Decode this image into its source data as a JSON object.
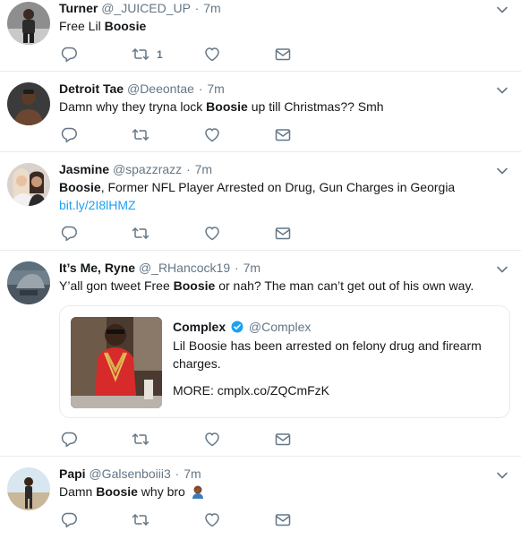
{
  "tweets": [
    {
      "name": "Turner",
      "handle": "@_JUICED_UP",
      "sep": "·",
      "time": "7m",
      "text_before": "Free Lil ",
      "text_bold": "Boosie",
      "text_after": "",
      "retweet_count": "1"
    },
    {
      "name": "Detroit Tae",
      "handle": "@Deeontae",
      "sep": "·",
      "time": "7m",
      "text_before": "Damn why they tryna lock ",
      "text_bold": "Boosie",
      "text_after": " up till Christmas?? Smh"
    },
    {
      "name": "Jasmine",
      "handle": "@spazzrazz",
      "sep": "·",
      "time": "7m",
      "text_bold": "Boosie",
      "text_after": ", Former NFL Player Arrested on Drug, Gun Charges in Georgia",
      "link": "bit.ly/2I8lHMZ"
    },
    {
      "name": "It’s Me, Ryne",
      "handle": "@_RHancock19",
      "sep": "·",
      "time": "7m",
      "text_before": "Y’all gon tweet Free ",
      "text_bold": "Boosie",
      "text_after": " or nah? The man can’t get out of his own way.",
      "quote": {
        "name": "Complex",
        "handle": "@Complex",
        "line1": "Lil Boosie has been arrested on felony drug and firearm",
        "line2": "charges.",
        "line3": "MORE: cmplx.co/ZQCmFzK"
      }
    },
    {
      "name": "Papi",
      "handle": "@Galsenboiii3",
      "sep": "·",
      "time": "7m",
      "text_before": "Damn ",
      "text_bold": "Boosie",
      "text_after": " why bro",
      "emoji": "facepalm-emoji"
    }
  ],
  "icons": {
    "reply": "reply-icon",
    "retweet": "retweet-icon",
    "like": "like-icon",
    "dm": "direct-message-icon",
    "caret": "chevron-down-icon",
    "verified": "verified-badge-icon"
  },
  "colors": {
    "text": "#14171a",
    "secondary": "#657786",
    "link": "#1da1f2",
    "border": "#e6ecf0"
  }
}
